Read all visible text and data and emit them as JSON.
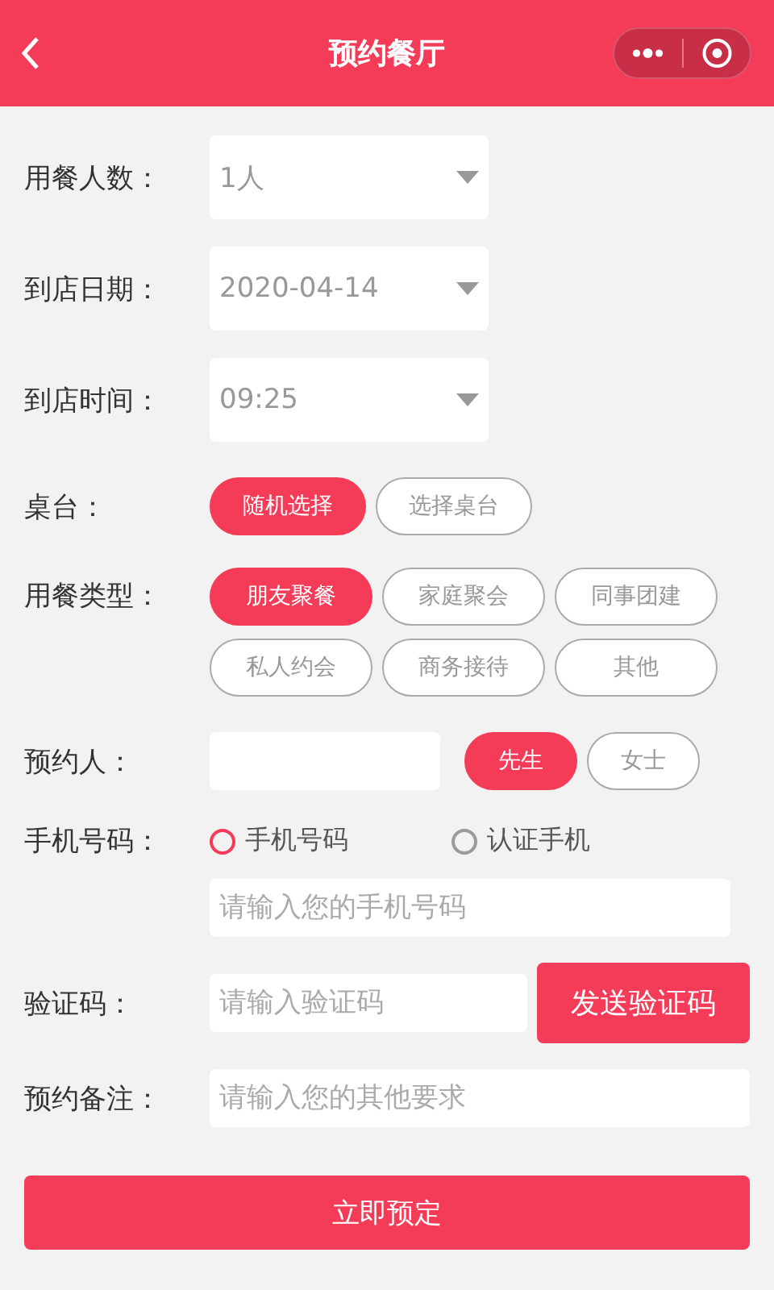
{
  "header": {
    "title": "预约餐厅"
  },
  "selects": [
    {
      "label": "用餐人数：",
      "value": "1人"
    },
    {
      "label": "到店日期：",
      "value": "2020-04-14"
    },
    {
      "label": "到店时间：",
      "value": "09:25"
    }
  ],
  "table": {
    "label": "桌台：",
    "options": [
      {
        "label": "随机选择",
        "selected": true
      },
      {
        "label": "选择桌台",
        "selected": false
      }
    ]
  },
  "meal_type": {
    "label": "用餐类型：",
    "options": [
      {
        "label": "朋友聚餐",
        "selected": true
      },
      {
        "label": "家庭聚会",
        "selected": false
      },
      {
        "label": "同事团建",
        "selected": false
      },
      {
        "label": "私人约会",
        "selected": false
      },
      {
        "label": "商务接待",
        "selected": false
      },
      {
        "label": "其他",
        "selected": false
      }
    ]
  },
  "booker": {
    "label": "预约人：",
    "titles": [
      {
        "label": "先生",
        "selected": true
      },
      {
        "label": "女士",
        "selected": false
      }
    ]
  },
  "phone": {
    "label": "手机号码：",
    "sources": [
      {
        "label": "手机号码",
        "selected": true
      },
      {
        "label": "认证手机",
        "selected": false
      }
    ],
    "placeholder": "请输入您的手机号码"
  },
  "code": {
    "label": "验证码：",
    "placeholder": "请输入验证码",
    "button": "发送验证码"
  },
  "remark": {
    "label": "预约备注：",
    "placeholder": "请输入您的其他要求"
  },
  "submit": "立即预定"
}
